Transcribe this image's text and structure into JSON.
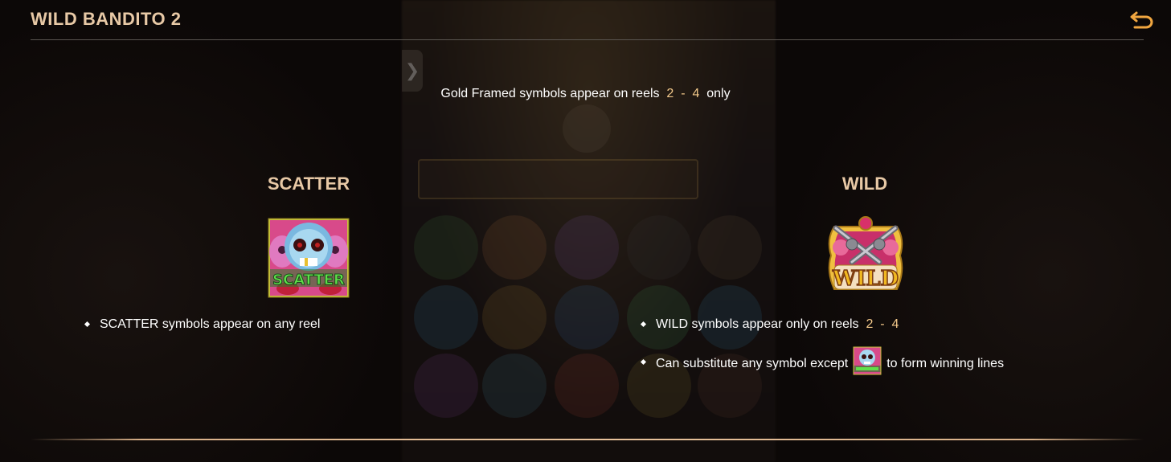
{
  "header": {
    "title": "WILD BANDITO 2",
    "back_icon": "return-arrow-icon"
  },
  "intro": {
    "text_before": "Gold Framed symbols appear on reels",
    "reel_from": "2",
    "dash": "-",
    "reel_to": "4",
    "text_after": "only"
  },
  "scatter": {
    "heading": "SCATTER",
    "symbol_label": "SCATTER",
    "bullets": [
      "SCATTER symbols appear on any reel"
    ]
  },
  "wild": {
    "heading": "WILD",
    "symbol_label": "WILD",
    "bullet1_text": "WILD symbols appear only on reels",
    "bullet1_from": "2",
    "bullet1_dash": "-",
    "bullet1_to": "4",
    "bullet2_before": "Can substitute any symbol except",
    "bullet2_after": "to form winning lines"
  },
  "colors": {
    "heading": "#e8c9a6",
    "body_text": "#ffffff",
    "number_highlight": "#f2c88a",
    "background": "#0c0807"
  }
}
